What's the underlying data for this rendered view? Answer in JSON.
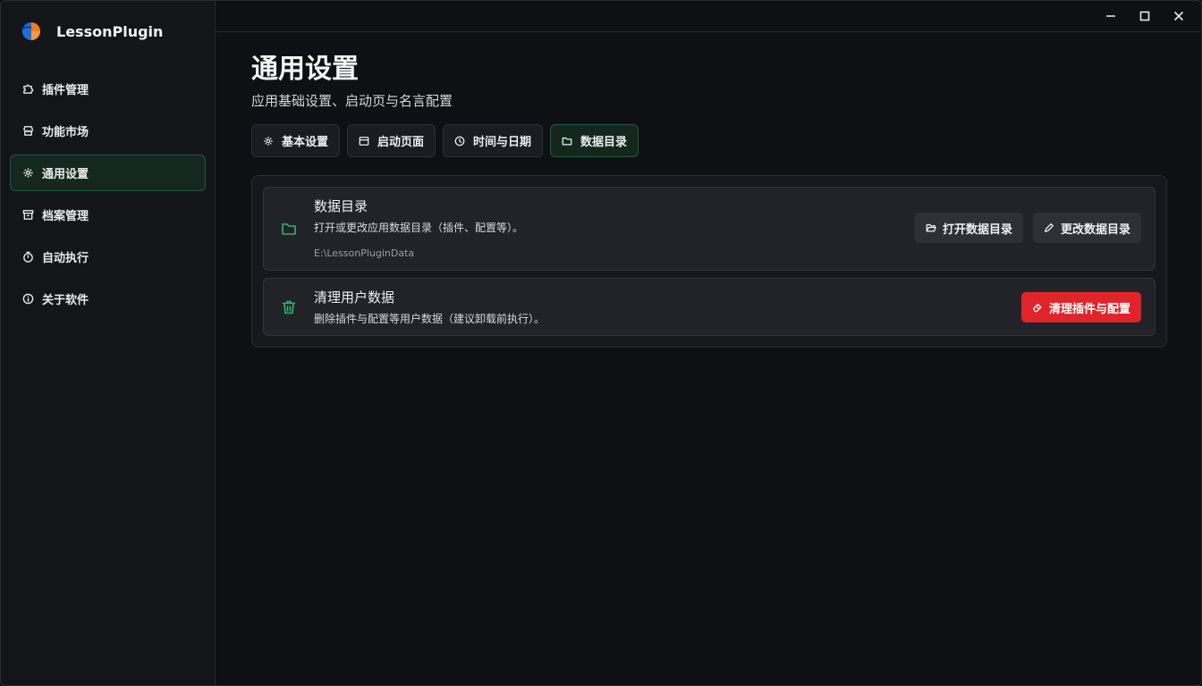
{
  "app": {
    "name": "LessonPlugin",
    "logo_colors": [
      "#1e6fd9",
      "#f07a1a"
    ]
  },
  "sidebar": {
    "items": [
      {
        "label": "插件管理",
        "icon": "puzzle-icon",
        "active": false
      },
      {
        "label": "功能市场",
        "icon": "store-icon",
        "active": false
      },
      {
        "label": "通用设置",
        "icon": "gear-icon",
        "active": true
      },
      {
        "label": "档案管理",
        "icon": "archive-icon",
        "active": false
      },
      {
        "label": "自动执行",
        "icon": "timer-icon",
        "active": false
      },
      {
        "label": "关于软件",
        "icon": "info-icon",
        "active": false
      }
    ]
  },
  "window_controls": {
    "minimize": "minimize-icon",
    "maximize": "maximize-icon",
    "close": "close-icon"
  },
  "page": {
    "title": "通用设置",
    "subtitle": "应用基础设置、启动页与名言配置"
  },
  "tabs": [
    {
      "label": "基本设置",
      "icon": "gear-icon",
      "active": false
    },
    {
      "label": "启动页面",
      "icon": "window-icon",
      "active": false
    },
    {
      "label": "时间与日期",
      "icon": "clock-icon",
      "active": false
    },
    {
      "label": "数据目录",
      "icon": "folder-icon",
      "active": true
    }
  ],
  "data_dir": {
    "title": "数据目录",
    "description": "打开或更改应用数据目录（插件、配置等）。",
    "path": "E:\\LessonPluginData",
    "open_button": "打开数据目录",
    "change_button": "更改数据目录",
    "icon": "folder-icon"
  },
  "clean": {
    "title": "清理用户数据",
    "description": "删除插件与配置等用户数据（建议卸载前执行）。",
    "button": "清理插件与配置",
    "icon": "trash-icon"
  },
  "colors": {
    "accent_green": "#2fb56a",
    "danger_red": "#e0242a",
    "active_bg": "#14281f"
  }
}
